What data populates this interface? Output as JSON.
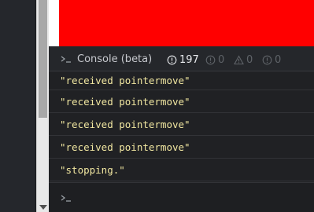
{
  "console": {
    "title": "Console (beta)",
    "counts": {
      "info": "197",
      "warnings": "0",
      "errors": "0",
      "other": "0"
    },
    "logs": [
      "\"received pointermove\"",
      "\"received pointermove\"",
      "\"received pointermove\"",
      "\"received pointermove\"",
      "\"stopping.\""
    ]
  },
  "colors": {
    "preview_fill": "#ff0000",
    "log_text": "#f0e6a0",
    "console_bg": "#202124"
  },
  "icons": {
    "prompt": "terminal-prompt-icon",
    "info": "info-circle-icon",
    "warning": "warning-triangle-icon",
    "error": "error-circle-icon"
  }
}
